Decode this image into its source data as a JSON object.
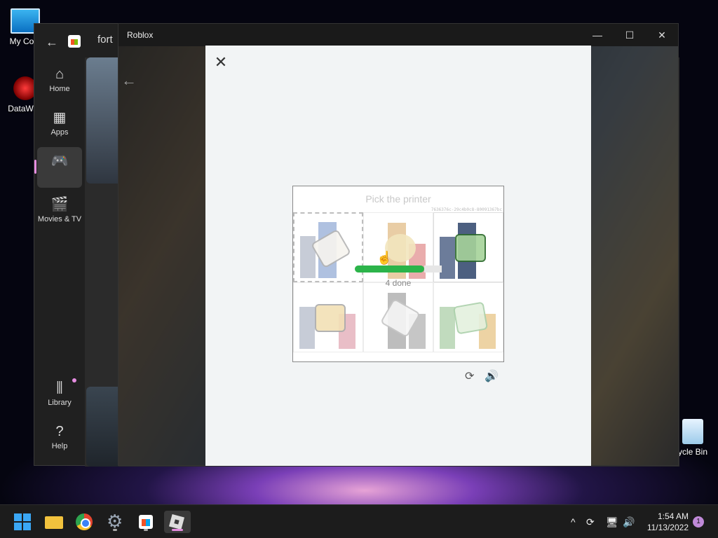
{
  "desktop": {
    "icons": [
      {
        "label": "My Com"
      },
      {
        "label": "DataWag"
      },
      {
        "label": "ycle Bin"
      }
    ]
  },
  "store": {
    "search_text": "fort",
    "nav": [
      {
        "label": "Home"
      },
      {
        "label": "Apps"
      },
      {
        "label": ""
      },
      {
        "label": "Movies & TV"
      }
    ],
    "nav_bottom": [
      {
        "label": "Library"
      },
      {
        "label": "Help"
      }
    ]
  },
  "roblox": {
    "title": "Roblox",
    "window_buttons": {
      "minimize": "—",
      "maximize": "☐",
      "close": "✕"
    }
  },
  "captcha": {
    "close": "✕",
    "prompt": "Pick the printer",
    "hash": "7636376c-29c4b0c8-80091367bc",
    "progress_label": "4 done",
    "progress_fraction": 0.8
  },
  "taskbar": {
    "time": "1:54 AM",
    "date": "11/13/2022",
    "notification_count": "1",
    "tray": {
      "chevron": "^",
      "sync": "⟳",
      "network": "🖥",
      "volume": "🔊"
    }
  },
  "icons": {
    "home": "home-icon",
    "apps": "apps-icon",
    "gaming": "gamepad-icon",
    "movies": "clapperboard-icon",
    "library": "library-icon",
    "help": "help-icon"
  },
  "colors": {
    "accent": "#e58de0",
    "progress": "#2cb44a"
  }
}
